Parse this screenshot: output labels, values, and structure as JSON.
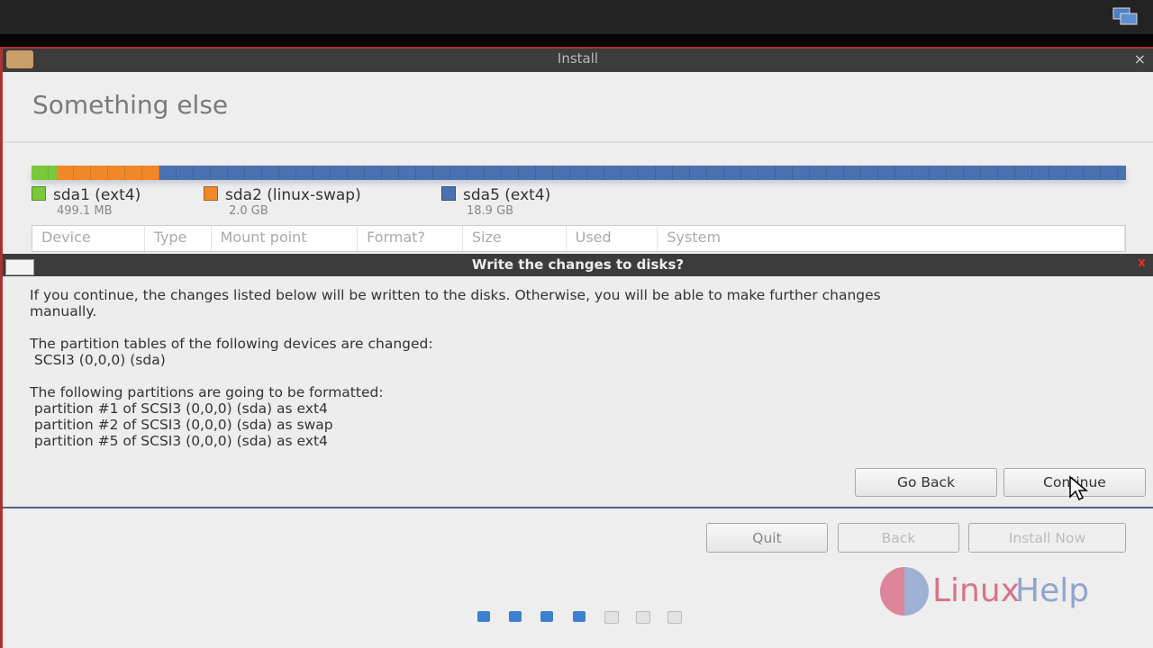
{
  "window": {
    "title": "Install",
    "close": "×"
  },
  "page": {
    "heading": "Something else"
  },
  "partitions": [
    {
      "name": "sda1 (ext4)",
      "size": "499.1 MB",
      "color": "#7ac93a",
      "fraction": 0.023
    },
    {
      "name": "sda2 (linux-swap)",
      "size": "2.0 GB",
      "color": "#f0882a",
      "fraction": 0.094
    },
    {
      "name": "sda5 (ext4)",
      "size": "18.9 GB",
      "color": "#4a72b0",
      "fraction": 0.883
    }
  ],
  "table": {
    "columns": [
      "Device",
      "Type",
      "Mount point",
      "Format?",
      "Size",
      "Used",
      "System"
    ]
  },
  "dialog": {
    "title": "Write the changes to disks?",
    "close": "x",
    "intro": "If you continue, the changes listed below will be written to the disks. Otherwise, you will be able to make further changes\nmanually.",
    "tables_header": "The partition tables of the following devices are changed:",
    "tables_items": [
      " SCSI3 (0,0,0) (sda)"
    ],
    "format_header": "The following partitions are going to be formatted:",
    "format_items": [
      " partition #1 of SCSI3 (0,0,0) (sda) as ext4",
      " partition #2 of SCSI3 (0,0,0) (sda) as swap",
      " partition #5 of SCSI3 (0,0,0) (sda) as ext4"
    ],
    "go_back": "Go Back",
    "continue": "Continue"
  },
  "footer": {
    "quit": "Quit",
    "back": "Back",
    "install_now": "Install Now"
  },
  "progress": {
    "total_steps": 7,
    "completed_steps": 4,
    "active_color": "#3d7fd0"
  },
  "watermark": {
    "text_a": "Linux",
    "text_b": "Help"
  }
}
